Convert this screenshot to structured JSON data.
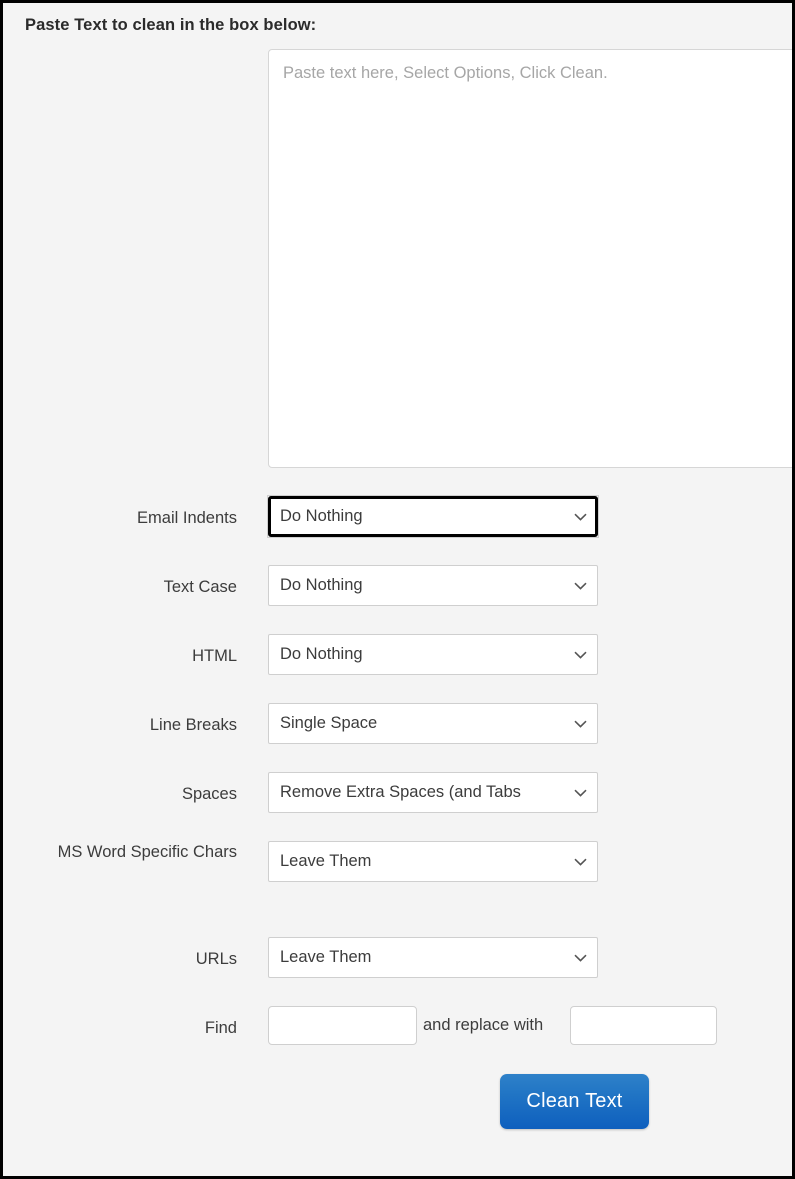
{
  "page": {
    "heading": "Paste Text to clean in the box below:",
    "frame_border_color": "#000000",
    "background_color": "#f4f4f4"
  },
  "textarea": {
    "name": "paste-text-area",
    "value": "",
    "placeholder": "Paste text here, Select Options, Click Clean."
  },
  "options": [
    {
      "id": "email-indents",
      "label": "Email Indents",
      "selected": "Do Nothing",
      "focused": true,
      "icon": "chevron-down-icon"
    },
    {
      "id": "text-case",
      "label": "Text Case",
      "selected": "Do Nothing",
      "focused": false,
      "icon": "chevron-down-icon"
    },
    {
      "id": "html",
      "label": "HTML",
      "selected": "Do Nothing",
      "focused": false,
      "icon": "chevron-down-icon"
    },
    {
      "id": "line-breaks",
      "label": "Line Breaks",
      "selected": "Single Space",
      "focused": false,
      "icon": "chevron-down-icon"
    },
    {
      "id": "spaces",
      "label": "Spaces",
      "selected": "Remove Extra Spaces (and Tabs",
      "focused": false,
      "icon": "chevron-down-icon"
    },
    {
      "id": "ms-word-specific-chars",
      "label": "MS Word Specific Chars",
      "selected": "Leave Them",
      "focused": false,
      "icon": "chevron-down-icon"
    },
    {
      "id": "urls",
      "label": "URLs",
      "selected": "Leave Them",
      "focused": false,
      "icon": "chevron-down-icon"
    }
  ],
  "find_replace": {
    "label": "Find",
    "between_text": "and replace with",
    "find_value": "",
    "replace_value": ""
  },
  "submit": {
    "label": "Clean Text",
    "color_top": "#2e81c9",
    "color_bottom": "#0e5fbe",
    "text_color": "#ffffff"
  }
}
